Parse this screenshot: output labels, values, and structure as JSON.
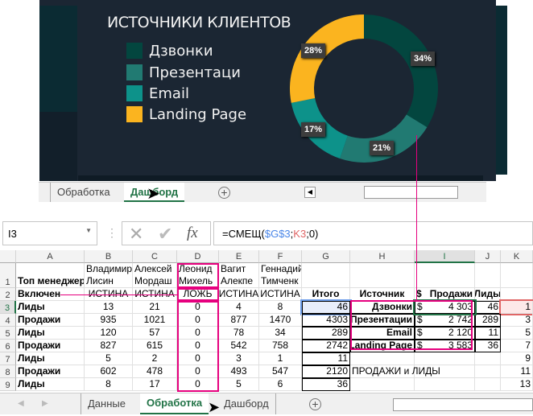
{
  "dashboard": {
    "title": "ИСТОЧНИКИ КЛИЕНТОВ",
    "legend": [
      {
        "label": "Дзвонки",
        "color": "#03463f"
      },
      {
        "label": "Презентаци",
        "color": "#217a72"
      },
      {
        "label": "Email",
        "color": "#0d928a"
      },
      {
        "label": "Landing Page",
        "color": "#fbb41f"
      }
    ],
    "labels": [
      "34%",
      "21%",
      "17%",
      "28%"
    ],
    "tabs": [
      "Обработка",
      "Дашборд"
    ],
    "active_tab": "Дашборд"
  },
  "chart_data": {
    "type": "pie",
    "variant": "donut",
    "title": "ИСТОЧНИКИ КЛИЕНТОВ",
    "categories": [
      "Дзвонки",
      "Презентаци",
      "Email",
      "Landing Page"
    ],
    "values": [
      4303,
      2742,
      2120,
      3583
    ],
    "percent_labels": [
      "34%",
      "21%",
      "17%",
      "28%"
    ],
    "colors": [
      "#03463f",
      "#217a72",
      "#0d928a",
      "#fbb41f"
    ],
    "legend": "left"
  },
  "formula_bar": {
    "name_box": "I3",
    "formula_prefix": "=СМЕЩ(",
    "ref1": "$G$3",
    "sep1": ";",
    "ref2": "K3",
    "suffix": ";0)",
    "ref1_color": "#4a86e8",
    "ref2_color": "#e06666"
  },
  "columns": [
    "A",
    "B",
    "C",
    "D",
    "E",
    "F",
    "G",
    "H",
    "I",
    "J",
    "K"
  ],
  "selected_column": "I",
  "rows": [
    {
      "n": "1",
      "cells": [
        "Топ менеджер",
        "Владимир Лисин",
        "Алексей Мордаш",
        "Леонид Михель",
        "Вагит Алекпе",
        "Геннадий Тимченк",
        "",
        "",
        "",
        "",
        ""
      ]
    },
    {
      "n": "2",
      "cells": [
        "Включен",
        "ИСТИНА",
        "ИСТИНА",
        "ЛОЖЬ",
        "ИСТИНА",
        "ИСТИНА",
        "Итого",
        "Источник",
        "Продажи",
        "Лиды",
        ""
      ]
    },
    {
      "n": "3",
      "cells": [
        "Лиды",
        "13",
        "21",
        "0",
        "4",
        "8",
        "46",
        "Дзвонки",
        "4 303",
        "46",
        "1"
      ]
    },
    {
      "n": "4",
      "cells": [
        "Продажи",
        "935",
        "1021",
        "0",
        "877",
        "1470",
        "4303",
        "Презентации",
        "2 742",
        "289",
        "3"
      ]
    },
    {
      "n": "5",
      "cells": [
        "Лиды",
        "120",
        "57",
        "0",
        "78",
        "34",
        "289",
        "Email",
        "2 120",
        "11",
        "5"
      ]
    },
    {
      "n": "6",
      "cells": [
        "Продажи",
        "827",
        "615",
        "0",
        "542",
        "758",
        "2742",
        "Landing Page",
        "3 583",
        "36",
        "7"
      ]
    },
    {
      "n": "7",
      "cells": [
        "Лиды",
        "5",
        "2",
        "0",
        "3",
        "1",
        "11",
        "",
        "",
        "",
        "9"
      ]
    },
    {
      "n": "8",
      "cells": [
        "Продажи",
        "602",
        "478",
        "0",
        "493",
        "547",
        "2120",
        "ПРОДАЖИ и ЛИДЫ",
        "",
        "",
        "11"
      ]
    },
    {
      "n": "9",
      "cells": [
        "Лиды",
        "8",
        "17",
        "0",
        "5",
        "6",
        "36",
        "",
        "",
        "",
        "13"
      ]
    }
  ],
  "currency": "$",
  "sheet_tabs": [
    "Данные",
    "Обработка",
    "Дашборд"
  ],
  "active_sheet": "Обработка"
}
